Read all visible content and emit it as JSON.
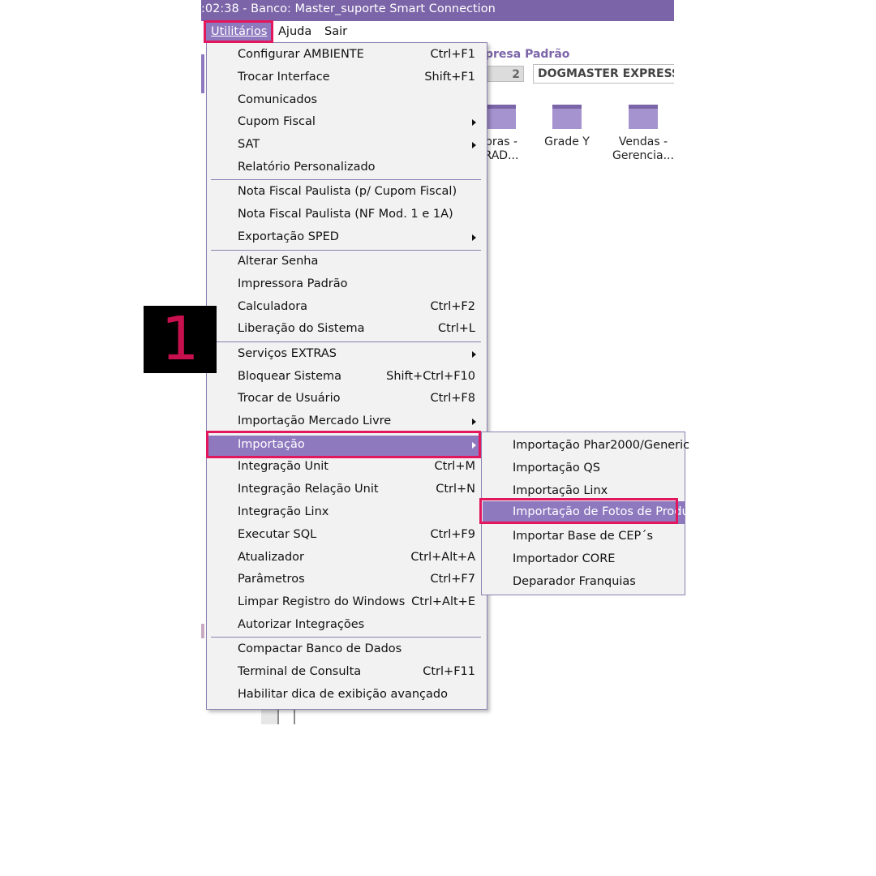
{
  "window": {
    "title": ":02:38 - Banco: Master_suporte Smart Connection"
  },
  "menubar": {
    "items": [
      "Utilitários",
      "Ajuda",
      "Sair"
    ]
  },
  "background": {
    "empresa_label": "presa Padrão",
    "empresa_code": "2",
    "empresa_name": "DOGMASTER EXPRESS",
    "icons": [
      {
        "label": "pras -\nRAD...",
        "icon": "window-icon"
      },
      {
        "label": "Grade Y",
        "icon": "window-icon"
      },
      {
        "label": "Vendas -\nGerencia...",
        "icon": "window-icon"
      }
    ]
  },
  "dropdown": {
    "items": [
      {
        "label": "Configurar AMBIENTE",
        "shortcut": "Ctrl+F1"
      },
      {
        "label": "Trocar Interface",
        "shortcut": "Shift+F1"
      },
      {
        "label": "Comunicados",
        "shortcut": ""
      },
      {
        "label": "Cupom Fiscal",
        "shortcut": "",
        "submenu": true
      },
      {
        "label": "SAT",
        "shortcut": "",
        "submenu": true
      },
      {
        "label": "Relatório Personalizado",
        "shortcut": ""
      },
      {
        "label": "Nota Fiscal Paulista (p/ Cupom Fiscal)",
        "shortcut": ""
      },
      {
        "label": "Nota Fiscal Paulista (NF Mod. 1 e 1A)",
        "shortcut": ""
      },
      {
        "label": "Exportação SPED",
        "shortcut": "",
        "submenu": true
      },
      {
        "label": "Alterar Senha",
        "shortcut": ""
      },
      {
        "label": "Impressora Padrão",
        "shortcut": ""
      },
      {
        "label": "Calculadora",
        "shortcut": "Ctrl+F2"
      },
      {
        "label": "Liberação do Sistema",
        "shortcut": "Ctrl+L"
      },
      {
        "label": "Serviços EXTRAS",
        "shortcut": "",
        "submenu": true
      },
      {
        "label": "Bloquear Sistema",
        "shortcut": "Shift+Ctrl+F10"
      },
      {
        "label": "Trocar de Usuário",
        "shortcut": "Ctrl+F8"
      },
      {
        "label": "Importação Mercado Livre",
        "shortcut": "",
        "submenu": true
      },
      {
        "label": "Importação",
        "shortcut": "",
        "submenu": true,
        "highlighted": true
      },
      {
        "label": "Integração Unit",
        "shortcut": "Ctrl+M"
      },
      {
        "label": "Integração Relação Unit",
        "shortcut": "Ctrl+N"
      },
      {
        "label": "Integração Linx",
        "shortcut": ""
      },
      {
        "label": "Executar SQL",
        "shortcut": "Ctrl+F9"
      },
      {
        "label": "Atualizador",
        "shortcut": "Ctrl+Alt+A"
      },
      {
        "label": "Parâmetros",
        "shortcut": "Ctrl+F7"
      },
      {
        "label": "Limpar Registro do Windows",
        "shortcut": "Ctrl+Alt+E"
      },
      {
        "label": "Autorizar  Integrações",
        "shortcut": ""
      },
      {
        "label": "Compactar Banco de Dados",
        "shortcut": ""
      },
      {
        "label": "Terminal de Consulta",
        "shortcut": "Ctrl+F11"
      },
      {
        "label": "Habilitar dica de exibição avançado",
        "shortcut": ""
      }
    ]
  },
  "submenu": {
    "items": [
      {
        "label": "Importação Phar2000/Generic"
      },
      {
        "label": "Importação QS"
      },
      {
        "label": "Importação Linx"
      },
      {
        "label": "Importação de Fotos de Produ",
        "highlighted": true
      },
      {
        "label": "Importar Base de CEP´s"
      },
      {
        "label": "Importador CORE"
      },
      {
        "label": "Deparador Franquias"
      }
    ]
  },
  "tutorial": {
    "step_number": "1",
    "highlight_color": "#e3175e"
  },
  "colors": {
    "titlebar": "#7b64a8",
    "menu_highlight": "#8e79bf",
    "menu_background": "#f2f2f2",
    "separator": "#8b7fb0"
  }
}
